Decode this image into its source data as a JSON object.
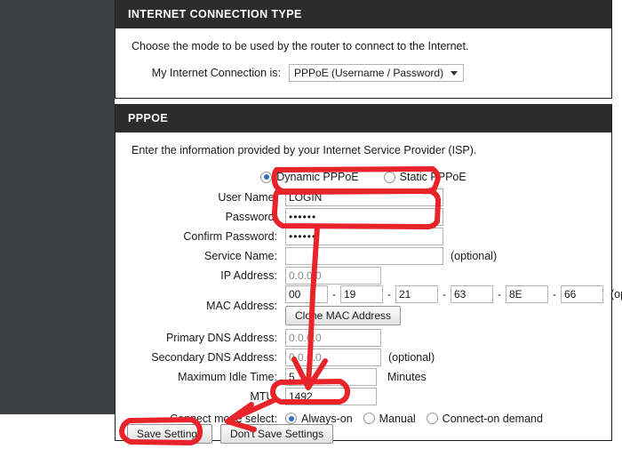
{
  "sections": {
    "connection_type": {
      "header": "INTERNET CONNECTION TYPE",
      "intro": "Choose the mode to be used by the router to connect to the Internet.",
      "label": "My Internet Connection is:",
      "selected_option": "PPPoE (Username / Password)"
    },
    "pppoe": {
      "header": "PPPOE",
      "intro": "Enter the information provided by your Internet Service Provider (ISP).",
      "mode_options": [
        {
          "label": "Dynamic PPPoE",
          "checked": true
        },
        {
          "label": "Static PPPoE",
          "checked": false
        }
      ],
      "fields": {
        "user_name": {
          "label": "User Name:",
          "value": "LOGIN"
        },
        "password": {
          "label": "Password:",
          "value": "••••••"
        },
        "confirm_password": {
          "label": "Confirm Password:",
          "value": "••••••"
        },
        "service_name": {
          "label": "Service Name:",
          "value": "",
          "optional": "(optional)"
        },
        "ip_address": {
          "label": "IP Address:",
          "value": "0.0.0.0"
        },
        "mac_address": {
          "label": "MAC Address:",
          "octets": [
            "00",
            "19",
            "21",
            "63",
            "8E",
            "66"
          ],
          "separator": "-",
          "optional": "(optional)",
          "clone_button": "Clone MAC Address"
        },
        "primary_dns": {
          "label": "Primary DNS Address:",
          "value": "0.0.0.0"
        },
        "secondary_dns": {
          "label": "Secondary DNS Address:",
          "value": "0.0.0.0",
          "optional": "(optional)"
        },
        "max_idle_time": {
          "label": "Maximum Idle Time:",
          "value": "5",
          "unit": "Minutes"
        },
        "mtu": {
          "label": "MTU:",
          "value": "1492"
        },
        "connect_mode": {
          "label": "Connect mode select:",
          "options": [
            {
              "label": "Always-on",
              "checked": true
            },
            {
              "label": "Manual",
              "checked": false
            },
            {
              "label": "Connect-on demand",
              "checked": false
            }
          ]
        }
      }
    }
  },
  "footer": {
    "save_label": "Save Settings",
    "dont_save_label": "Don't Save Settings"
  },
  "annotation": {
    "color": "#e8232a",
    "shapes": [
      "oval-username",
      "oval-passwords",
      "arrow-to-always-on",
      "oval-always-on",
      "arrow-to-save",
      "oval-save-settings"
    ]
  }
}
